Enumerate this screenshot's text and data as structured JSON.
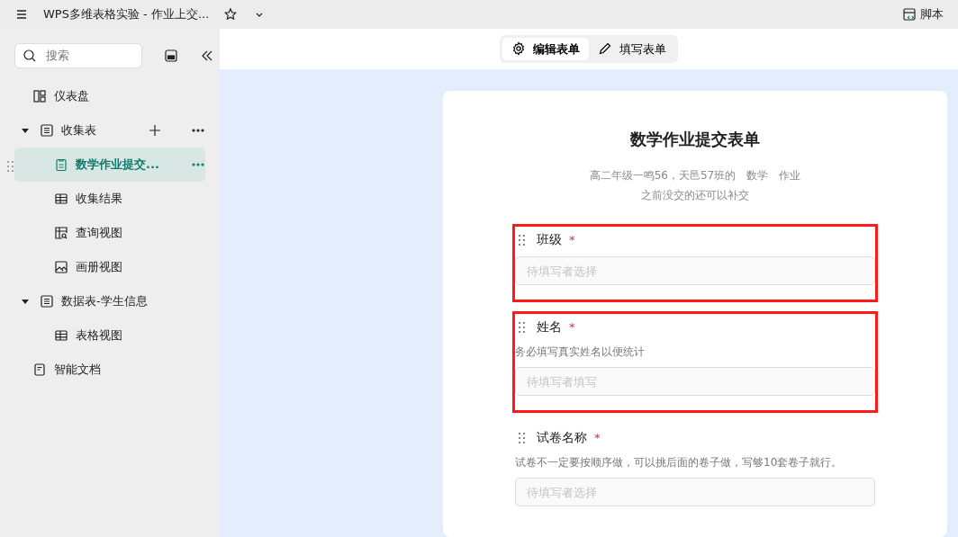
{
  "window": {
    "title": "WPS多维表格实验 - 作业上交...",
    "right_action": "脚本"
  },
  "sidebar": {
    "search": {
      "placeholder": "搜索"
    },
    "items": [
      {
        "label": "仪表盘",
        "kind": "dashboard",
        "selected": false
      },
      {
        "label": "收集表",
        "kind": "sheet",
        "selected": false,
        "expanded": true,
        "children": [
          {
            "label": "数学作业提交...",
            "kind": "form",
            "selected": true
          },
          {
            "label": "收集结果",
            "kind": "grid",
            "selected": false
          },
          {
            "label": "查询视图",
            "kind": "query",
            "selected": false
          },
          {
            "label": "画册视图",
            "kind": "gallery",
            "selected": false
          }
        ]
      },
      {
        "label": "数据表-学生信息",
        "kind": "sheet",
        "selected": false,
        "expanded": true,
        "children": [
          {
            "label": "表格视图",
            "kind": "grid",
            "selected": false
          }
        ]
      },
      {
        "label": "智能文档",
        "kind": "doc",
        "selected": false
      }
    ]
  },
  "mode_tabs": [
    {
      "label": "编辑表单",
      "kind": "gear",
      "selected": true
    },
    {
      "label": "填写表单",
      "kind": "pencil",
      "selected": false
    }
  ],
  "form": {
    "title": "数学作业提交表单",
    "description": [
      "高二年级一鸣56，天邑57班的　数学　作业",
      "之前没交的还可以补交"
    ],
    "fields": [
      {
        "label": "班级",
        "required_mark": "*",
        "placeholder": "待填写者选择",
        "highlighted": true
      },
      {
        "label": "姓名",
        "required_mark": "*",
        "hint": "务必填写真实姓名以便统计",
        "placeholder": "待填写者填写",
        "highlighted": true
      },
      {
        "label": "试卷名称",
        "required_mark": "*",
        "hint": "试卷不一定要按顺序做，可以挑后面的卷子做，写够10套卷子就行。",
        "placeholder": "待填写者选择",
        "highlighted": false
      }
    ]
  }
}
